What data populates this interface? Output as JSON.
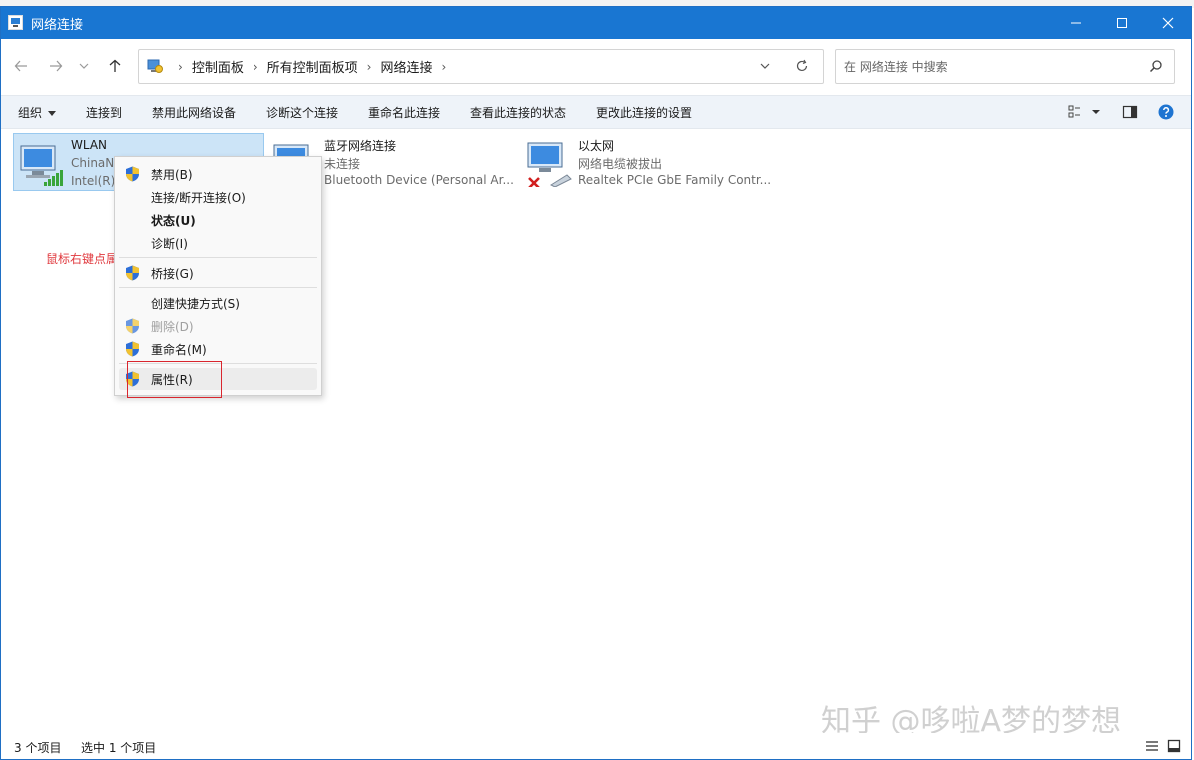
{
  "window": {
    "title": "网络连接"
  },
  "address": {
    "breadcrumbs": [
      "控制面板",
      "所有控制面板项",
      "网络连接"
    ],
    "crumb_sep": "›"
  },
  "search": {
    "placeholder": "在 网络连接 中搜索"
  },
  "toolbar": {
    "organize": "组织",
    "connect_to": "连接到",
    "disable_device": "禁用此网络设备",
    "diagnose": "诊断这个连接",
    "rename": "重命名此连接",
    "view_status": "查看此连接的状态",
    "change_settings": "更改此连接的设置"
  },
  "items": [
    {
      "name": "WLAN",
      "status": "ChinaNe",
      "device": "Intel(R)"
    },
    {
      "name": "蓝牙网络连接",
      "status": "未连接",
      "device": "Bluetooth Device (Personal Ar..."
    },
    {
      "name": "以太网",
      "status": "网络电缆被拔出",
      "device": "Realtek PCIe GbE Family Contr..."
    }
  ],
  "context_menu": {
    "disable": "禁用(B)",
    "connect_disconnect": "连接/断开连接(O)",
    "status": "状态(U)",
    "diagnose": "诊断(I)",
    "bridge": "桥接(G)",
    "create_shortcut": "创建快捷方式(S)",
    "delete": "删除(D)",
    "rename": "重命名(M)",
    "properties": "属性(R)"
  },
  "annotation": "鼠标右键点属性",
  "watermark": "知乎 @哆啦A梦的梦想",
  "status_bar": {
    "count": "3 个项目",
    "selected": "选中 1 个项目"
  },
  "colors": {
    "titlebar": "#1976d2",
    "selection": "#cce4f7",
    "annotation": "#e0393e",
    "highlight_box": "#d9262e"
  },
  "icons": [
    "back-arrow-icon",
    "forward-arrow-icon",
    "chevron-down-icon",
    "up-arrow-icon",
    "control-panel-icon",
    "refresh-icon",
    "search-icon",
    "view-options-icon",
    "preview-pane-icon",
    "help-icon",
    "network-computer-icon",
    "uac-shield-icon",
    "details-view-icon",
    "tiles-view-icon"
  ]
}
